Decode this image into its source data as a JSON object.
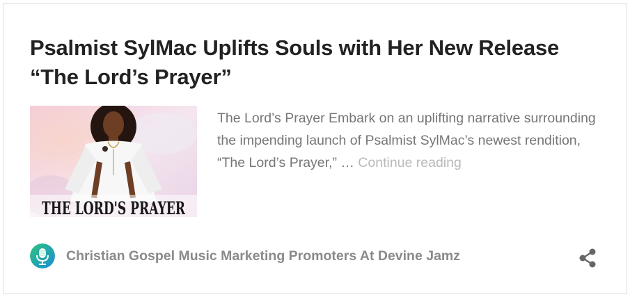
{
  "post": {
    "title_line1": "Psalmist SylMac Uplifts Souls with Her New Release",
    "title_line2": "“The Lord’s Prayer”",
    "thumbnail_caption": "THE LORD'S PRAYER",
    "excerpt": "The Lord’s Prayer Embark on an uplifting narrative surrounding the impending launch of Psalmist SylMac’s newest rendition, “The Lord’s Prayer,” … ",
    "continue_label": "Continue reading"
  },
  "footer": {
    "author": "Christian Gospel Music Marketing Promoters At Devine Jamz",
    "avatar_icon": "microphone-icon",
    "share_icon": "share-icon"
  },
  "colors": {
    "title": "#222222",
    "excerpt": "#767676",
    "continue": "#b9b9b9",
    "author": "#8a8a8a",
    "share": "#666666",
    "avatar_start": "#2ec27e",
    "avatar_end": "#1a8fd6"
  }
}
